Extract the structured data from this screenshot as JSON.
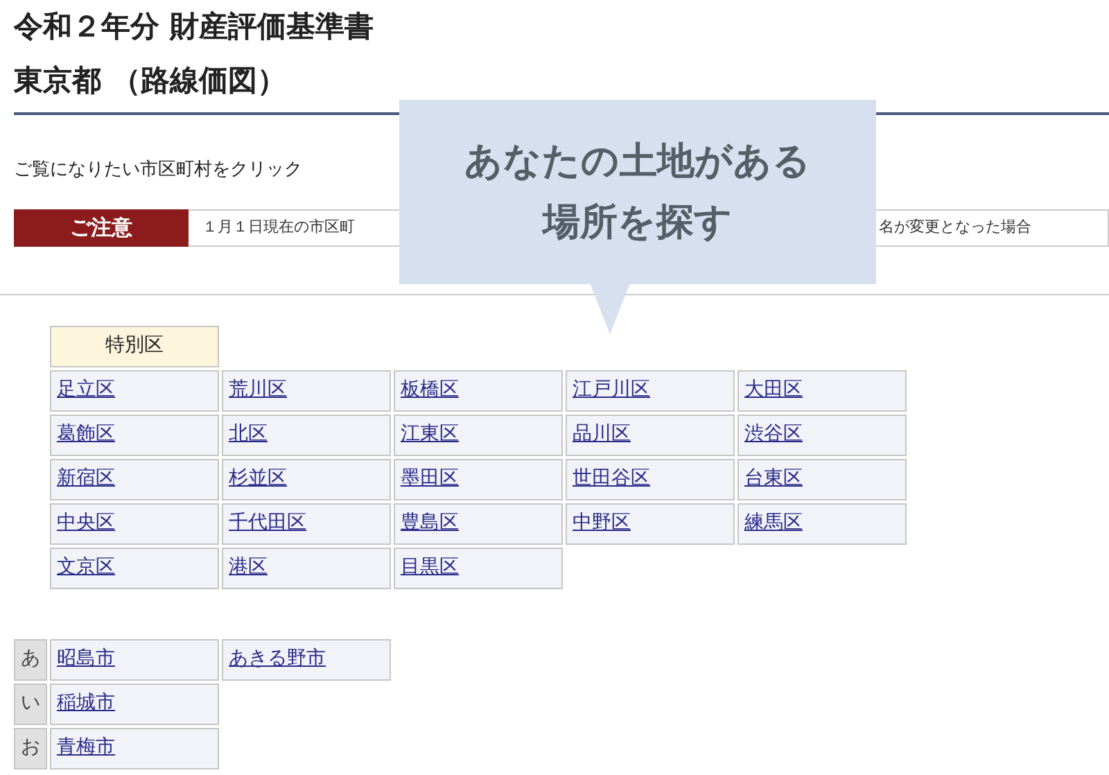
{
  "title_lines": [
    "令和２年分 財産評価基準書",
    "東京都 （路線価図）"
  ],
  "instruction": "ご覧になりたい市区町村をクリック",
  "notice": {
    "label": "ご注意",
    "text_before": "１月１日現在の市区町",
    "text_after": "名が変更となった場合"
  },
  "callout": {
    "lines": [
      "あなたの土地がある",
      "場所を探す"
    ]
  },
  "special_wards": {
    "heading": "特別区",
    "rows": [
      [
        "足立区",
        "荒川区",
        "板橋区",
        "江戸川区",
        "大田区"
      ],
      [
        "葛飾区",
        "北区",
        "江東区",
        "品川区",
        "渋谷区"
      ],
      [
        "新宿区",
        "杉並区",
        "墨田区",
        "世田谷区",
        "台東区"
      ],
      [
        "中央区",
        "千代田区",
        "豊島区",
        "中野区",
        "練馬区"
      ],
      [
        "文京区",
        "港区",
        "目黒区"
      ]
    ]
  },
  "cities": [
    {
      "kana": "あ",
      "items": [
        "昭島市",
        "あきる野市"
      ]
    },
    {
      "kana": "い",
      "items": [
        "稲城市"
      ]
    },
    {
      "kana": "お",
      "items": [
        "青梅市"
      ]
    }
  ]
}
